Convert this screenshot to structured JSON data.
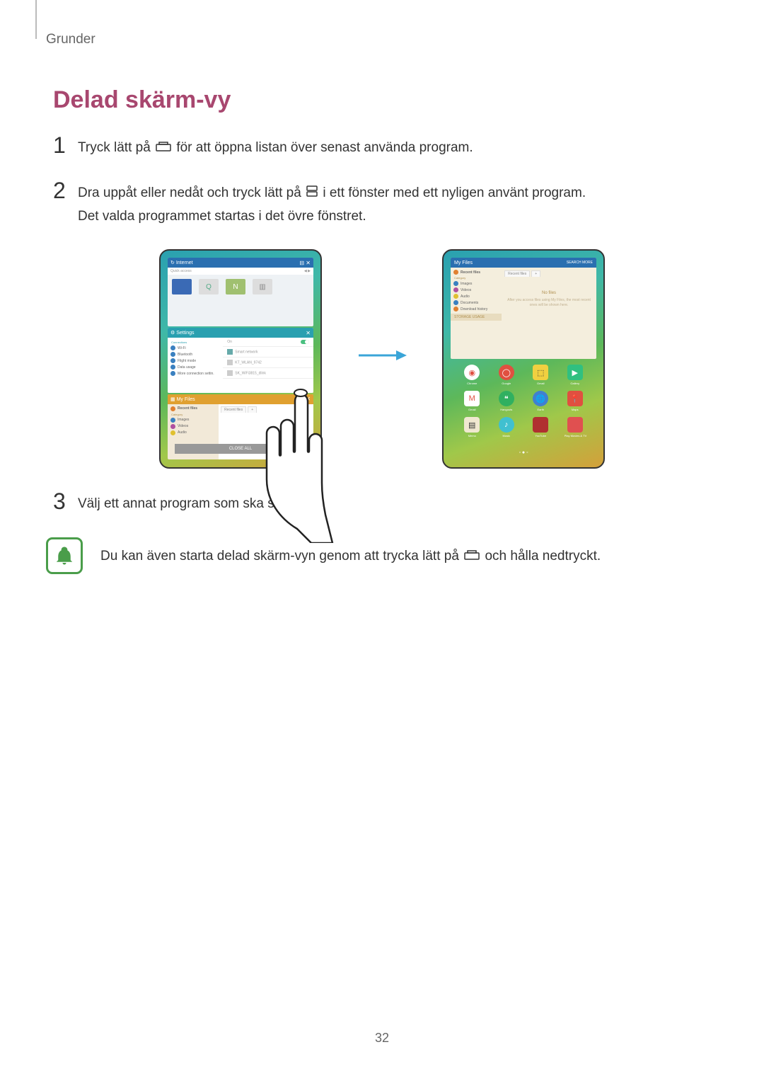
{
  "breadcrumb": "Grunder",
  "title": "Delad skärm-vy",
  "steps": {
    "s1": {
      "num": "1",
      "pre": "Tryck lätt på ",
      "post": " för att öppna listan över senast använda program."
    },
    "s2": {
      "num": "2",
      "line1_pre": "Dra uppåt eller nedåt och tryck lätt på ",
      "line1_post": " i ett fönster med ett nyligen använt program.",
      "line2": "Det valda programmet startas i det övre fönstret."
    },
    "s3": {
      "num": "3",
      "text": "Välj ett annat program som ska startas."
    }
  },
  "note": {
    "pre": "Du kan även starta delad skärm-vyn genom att trycka lätt på ",
    "post": " och hålla nedtryckt."
  },
  "fig1": {
    "win1": {
      "title": "Internet",
      "icons": "⊟ ✕",
      "quick": "Quick access"
    },
    "win2": {
      "title": "Settings",
      "close": "✕",
      "left": [
        "Wi-Fi",
        "Bluetooth",
        "Flight mode",
        "Data usage",
        "More connection settin."
      ],
      "right_on": "On",
      "right_on2": "On",
      "r1": "Smart network",
      "r2": "KT_WLAN_9742",
      "r3": "SK_WiFi3815_dlink"
    },
    "win3": {
      "title": "My Files",
      "icons": "⊟ ✕",
      "recent": "Recent files",
      "cat": "Category",
      "items": [
        "Images",
        "Videos",
        "Audio"
      ],
      "tabs": [
        "Recent files",
        "+"
      ],
      "close_all": "CLOSE ALL"
    }
  },
  "fig2": {
    "hdr": {
      "title": "My Files",
      "right": "SEARCH   MORE"
    },
    "left": {
      "recent": "Recent files",
      "cat": "Category",
      "items": [
        "Images",
        "Videos",
        "Audio",
        "Documents",
        "Download history"
      ],
      "storage": "STORAGE USAGE"
    },
    "right": {
      "tabs": [
        "Recent files",
        "+"
      ],
      "empty1": "No files",
      "empty2": "After you access files using My Files, the most recent ones will be shown here."
    },
    "apps_row1": [
      "Chrome",
      "Google",
      "Gmail",
      "Gallery"
    ],
    "apps_row2": [
      "Gmail",
      "Hangouts",
      "Earth",
      "Maps"
    ],
    "apps_row3": [
      "Memo",
      "Music",
      "YouTube",
      "Play Movies & TV"
    ],
    "dots": "◦ ● ◦"
  },
  "page_number": "32"
}
